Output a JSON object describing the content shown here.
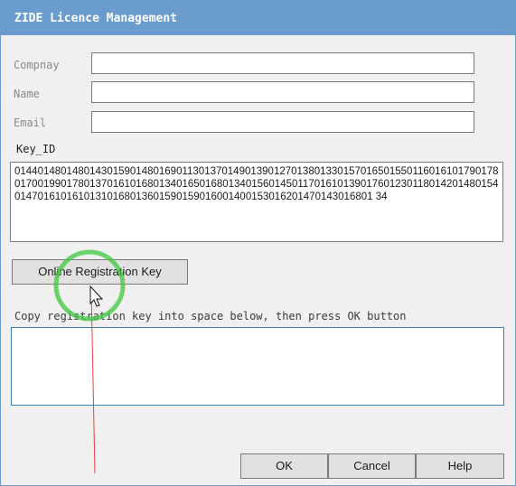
{
  "window": {
    "title": "ZIDE Licence Management"
  },
  "form": {
    "company_label": "Compnay",
    "company_value": "",
    "name_label": "Name",
    "name_value": "",
    "email_label": "Email",
    "email_value": ""
  },
  "key": {
    "label": "Key_ID",
    "value": "01440148014801430159014801690113013701490139012701380133015701650155011601610179017801700199017801370161016801340165016801340156014501170161013901760123011801420148015401470161016101310168013601590159016001400153016201470143016801 34"
  },
  "registration": {
    "online_button_label": "Online Registration Key",
    "instruction": "Copy registration key into space below, then press OK button",
    "key_value": ""
  },
  "buttons": {
    "ok_label": "OK",
    "cancel_label": "Cancel",
    "help_label": "Help"
  },
  "cursor": {
    "type": "arrow-pointer",
    "highlight_color": "#3cc83c",
    "trail_color": "#e8403a"
  }
}
